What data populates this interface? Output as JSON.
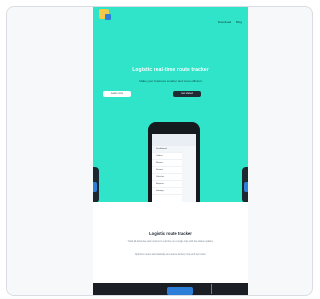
{
  "screenshot": {
    "header": {
      "nav_items": [
        "Download",
        "Blog"
      ]
    },
    "hero": {
      "headline": "Logistic real-time route tracker",
      "subheadline": "Make your business smarter and more efficient",
      "buttons": [
        "Learn more",
        "Get started"
      ]
    },
    "phone": {
      "menu_items": [
        "Dashboard",
        "Orders",
        "Routes",
        "Drivers",
        "Vehicles",
        "Reports",
        "Settings"
      ]
    },
    "section": {
      "title": "Logistic route tracker",
      "paragraph_1": "Track all deliveries and couriers in real time on a single map with live status updates.",
      "paragraph_2": "Optimize routes automatically and reduce delivery time and fuel costs."
    }
  },
  "colors": {
    "hero_bg": "#2fe4c9",
    "dark": "#151a1f",
    "accent": "#2d7ed8"
  }
}
